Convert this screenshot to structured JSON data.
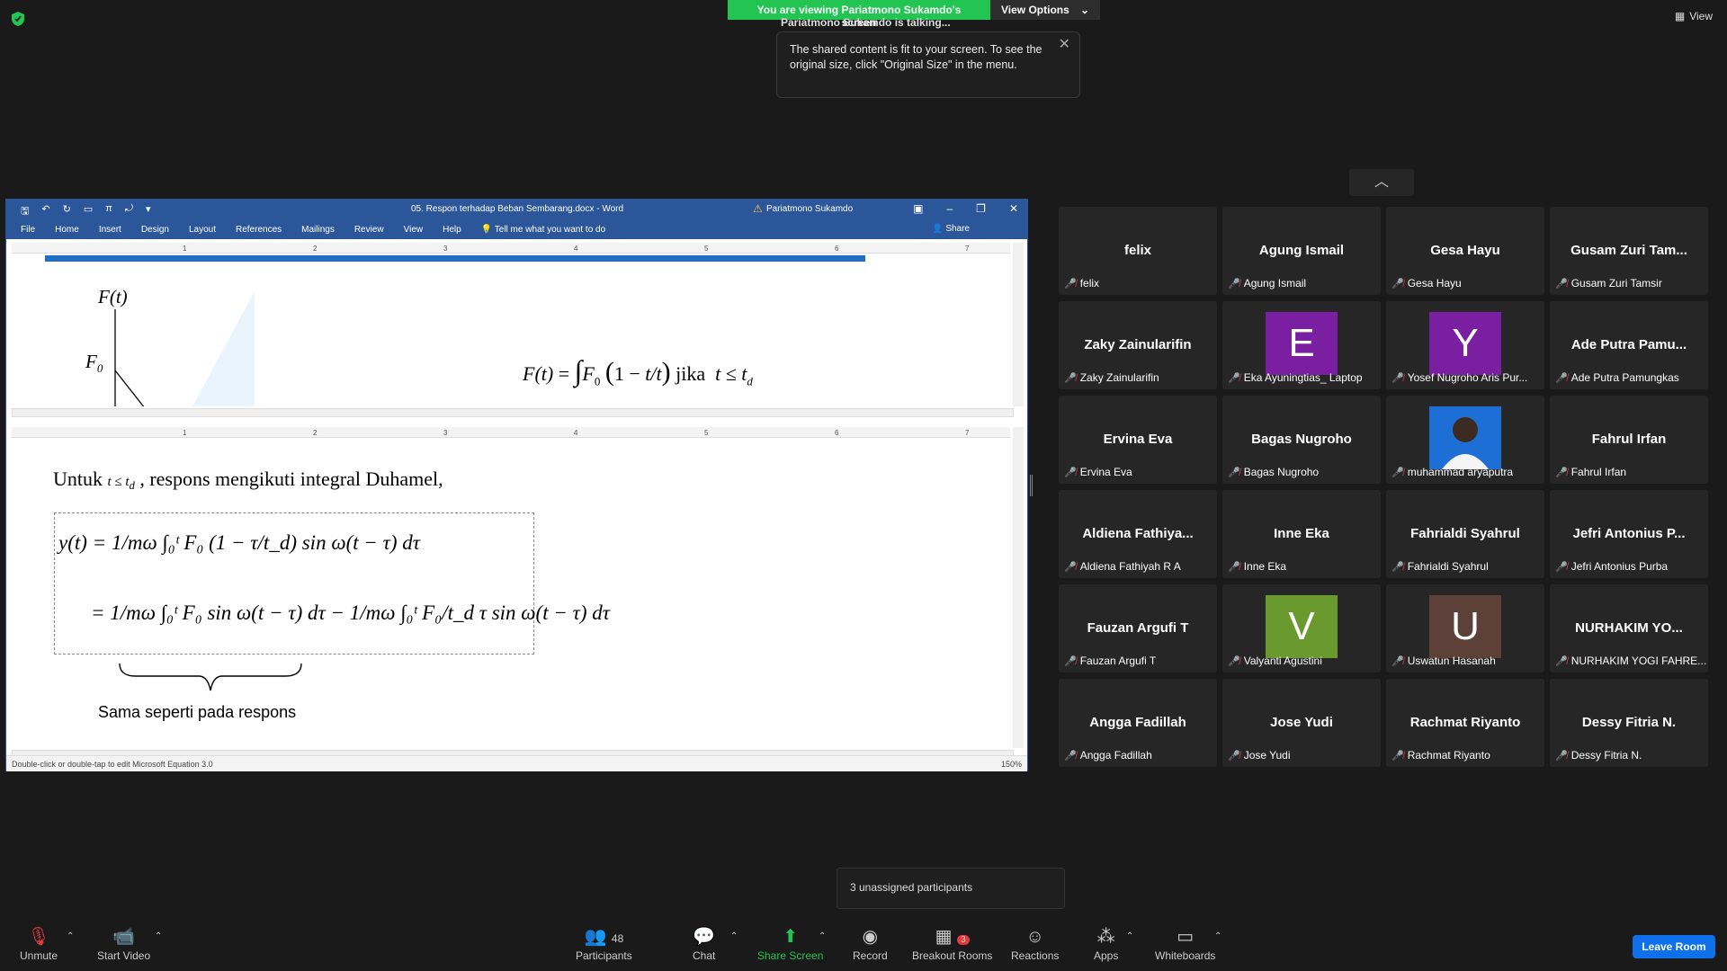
{
  "top": {
    "banner_text": "You are viewing Pariatmono Sukamdo's screen",
    "view_options": "View Options",
    "talking": "Pariatmono Sukamdo is talking...",
    "tooltip": "The shared content is fit to your screen. To see the original size, click \"Original Size\" in the menu.",
    "view_label": "View"
  },
  "word": {
    "doc_title": "05. Respon terhadap Beban Sembarang.docx - Word",
    "user": "Pariatmono Sukamdo",
    "menu": [
      "File",
      "Home",
      "Insert",
      "Design",
      "Layout",
      "References",
      "Mailings",
      "Review",
      "View",
      "Help",
      "Tell me what you want to do"
    ],
    "share": "Share",
    "ruler_ticks": [
      "1",
      "2",
      "3",
      "4",
      "5",
      "6",
      "7"
    ],
    "status": "Double-click or double-tap to edit Microsoft Equation 3.0",
    "zoom": "150%",
    "top_pane": {
      "ft_label": "F(t)",
      "f0_label": "F",
      "f0_sub": "0",
      "formula": "F(t) = F₀ (1 − t/t_d) jika t ≤ t_d",
      "jika": "jika",
      "cond": "t ≤ t"
    },
    "bottom_pane": {
      "intro_1": "Untuk",
      "intro_2": ", respons mengikuti integral Duhamel,",
      "eq1": "y(t) = 1/mω ∫₀ᵗ F₀ (1 − τ/t_d) sin ω(t − τ) dτ",
      "eq2": "= 1/mω ∫₀ᵗ F₀ sin ω(t − τ) dτ − 1/mω ∫₀ᵗ F₀/t_d τ sin ω(t − τ) dτ",
      "brace_label": "Sama seperti pada respons"
    }
  },
  "participants": [
    {
      "big": "felix",
      "name": "felix"
    },
    {
      "big": "Agung Ismail",
      "name": "Agung Ismail"
    },
    {
      "big": "Gesa Hayu",
      "name": "Gesa Hayu"
    },
    {
      "big": "Gusam Zuri Tam...",
      "name": "Gusam Zuri Tamsir"
    },
    {
      "big": "Zaky Zainularifin",
      "name": "Zaky Zainularifin"
    },
    {
      "avatar": "E",
      "color": "#7b1fa2",
      "name": "Eka Ayuningtias_ Laptop"
    },
    {
      "avatar": "Y",
      "color": "#7b1fa2",
      "name": "Yosef Nugroho Aris Pur..."
    },
    {
      "big": "Ade Putra Pamu...",
      "name": "Ade Putra Pamungkas"
    },
    {
      "big": "Ervina Eva",
      "name": "Ervina Eva"
    },
    {
      "big": "Bagas Nugroho",
      "name": "Bagas Nugroho"
    },
    {
      "photo": true,
      "color": "#1d6fd6",
      "name": "muhammad aryaputra"
    },
    {
      "big": "Fahrul Irfan",
      "name": "Fahrul Irfan"
    },
    {
      "big": "Aldiena  Fathiya...",
      "name": "Aldiena Fathiyah R A"
    },
    {
      "big": "Inne Eka",
      "name": "Inne Eka"
    },
    {
      "big": "Fahrialdi Syahrul",
      "name": "Fahrialdi Syahrul"
    },
    {
      "big": "Jefri Antonius P...",
      "name": "Jefri Antonius Purba"
    },
    {
      "big": "Fauzan Argufi T",
      "name": "Fauzan Argufi T"
    },
    {
      "avatar": "V",
      "color": "#6a9a2e",
      "name": "Valyanti Agustini"
    },
    {
      "avatar": "U",
      "color": "#5d4037",
      "name": "Uswatun Hasanah"
    },
    {
      "big": "NURHAKIM YO...",
      "name": "NURHAKIM YOGI FAHRE..."
    },
    {
      "big": "Angga Fadillah",
      "name": "Angga Fadillah"
    },
    {
      "big": "Jose Yudi",
      "name": "Jose Yudi"
    },
    {
      "big": "Rachmat Riyanto",
      "name": "Rachmat Riyanto"
    },
    {
      "big": "Dessy Fitria N.",
      "name": "Dessy Fitria N."
    }
  ],
  "toolbar": {
    "unassigned": "3 unassigned participants",
    "unmute": "Unmute",
    "start_video": "Start Video",
    "participants": "Participants",
    "participants_count": "48",
    "chat": "Chat",
    "share_screen": "Share Screen",
    "record": "Record",
    "breakout": "Breakout Rooms",
    "breakout_badge": "3",
    "reactions": "Reactions",
    "apps": "Apps",
    "whiteboards": "Whiteboards",
    "leave": "Leave Room"
  }
}
